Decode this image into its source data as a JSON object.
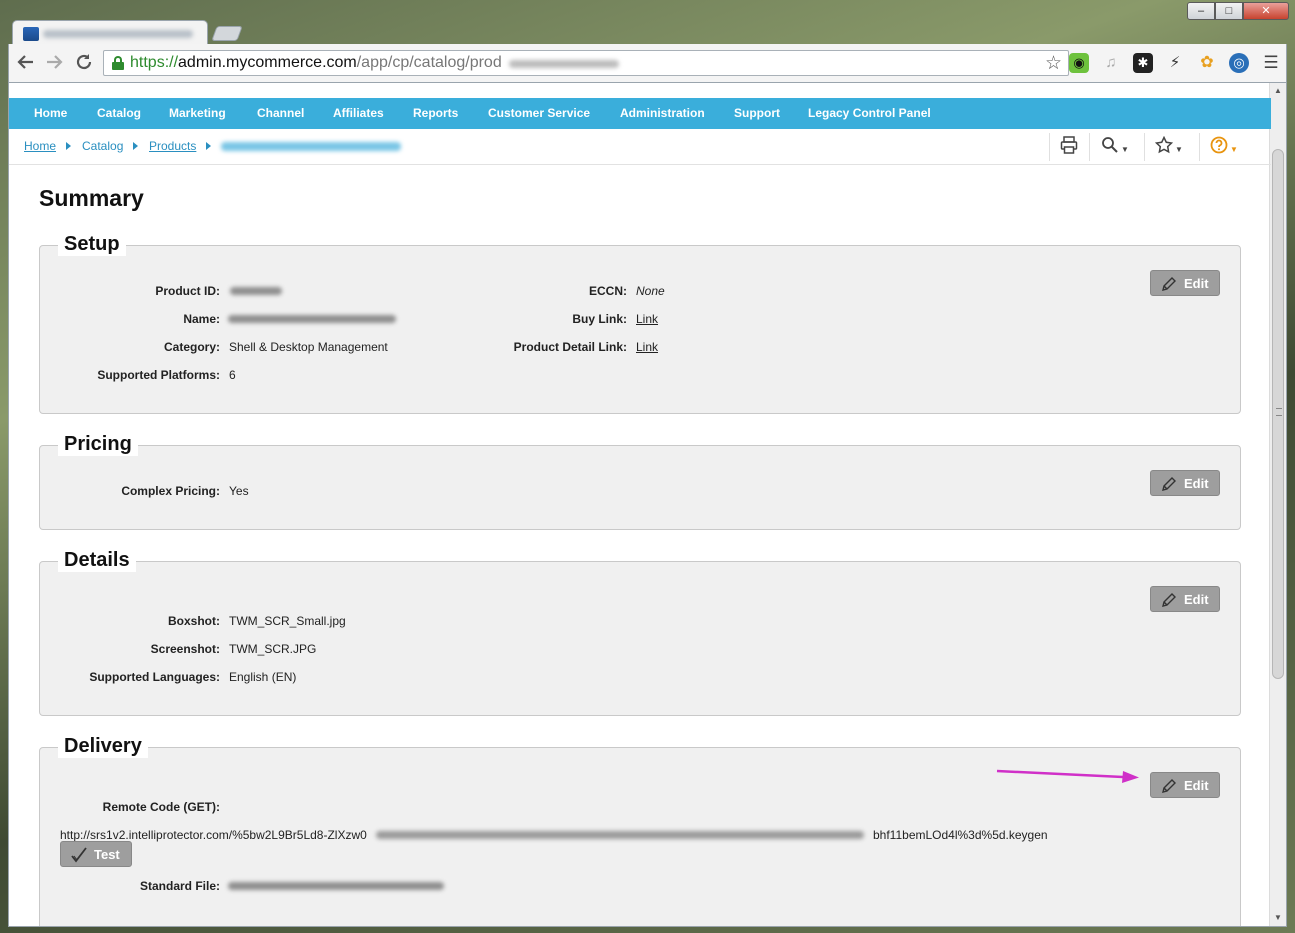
{
  "browser": {
    "window_controls": {
      "minimize": "–",
      "maximize": "□",
      "close": "✕"
    },
    "back_icon": "arrow-left-icon",
    "forward_icon": "arrow-right-icon",
    "reload_icon": "reload-icon",
    "url": {
      "scheme": "https://",
      "host": "admin.mycommerce.com",
      "path": "/app/cp/catalog/prod"
    },
    "bookmark_icon": "star-outline-icon",
    "menu_icon": "hamburger-icon"
  },
  "nav": {
    "items": [
      "Home",
      "Catalog",
      "Marketing",
      "Channel",
      "Affiliates",
      "Reports",
      "Customer Service",
      "Administration",
      "Support",
      "Legacy Control Panel"
    ]
  },
  "breadcrumb": {
    "home": "Home",
    "catalog": "Catalog",
    "products": "Products"
  },
  "page": {
    "title": "Summary"
  },
  "setup": {
    "title": "Setup",
    "edit_label": "Edit",
    "product_id_label": "Product ID:",
    "name_label": "Name:",
    "category_label": "Category:",
    "category_value": "Shell & Desktop Management",
    "platforms_label": "Supported Platforms:",
    "platforms_value": "6",
    "eccn_label": "ECCN:",
    "eccn_value": "None",
    "buy_link_label": "Buy Link:",
    "buy_link_value": "Link",
    "detail_link_label": "Product Detail Link:",
    "detail_link_value": "Link"
  },
  "pricing": {
    "title": "Pricing",
    "edit_label": "Edit",
    "complex_label": "Complex Pricing:",
    "complex_value": "Yes"
  },
  "details": {
    "title": "Details",
    "edit_label": "Edit",
    "boxshot_label": "Boxshot:",
    "boxshot_value": "TWM_SCR_Small.jpg",
    "screenshot_label": "Screenshot:",
    "screenshot_value": "TWM_SCR.JPG",
    "languages_label": "Supported Languages:",
    "languages_value": "English (EN)"
  },
  "delivery": {
    "title": "Delivery",
    "edit_label": "Edit",
    "remote_label": "Remote Code (GET):",
    "remote_url_start": "http://srs1v2.intelliprotector.com/%5bw2L9Br5Ld8-ZlXzw0",
    "remote_url_end": "bhf11bemLOd4l%3d%5d.keygen",
    "test_label": "Test",
    "standard_file_label": "Standard File:"
  },
  "colors": {
    "nav_bar": "#3aaedb",
    "link": "#2a8fc0",
    "panel_bg": "#f0f0f0",
    "button_bg": "#9e9e9e",
    "annotation_arrow": "#d030c8",
    "secure_green": "#2e8b2e"
  }
}
